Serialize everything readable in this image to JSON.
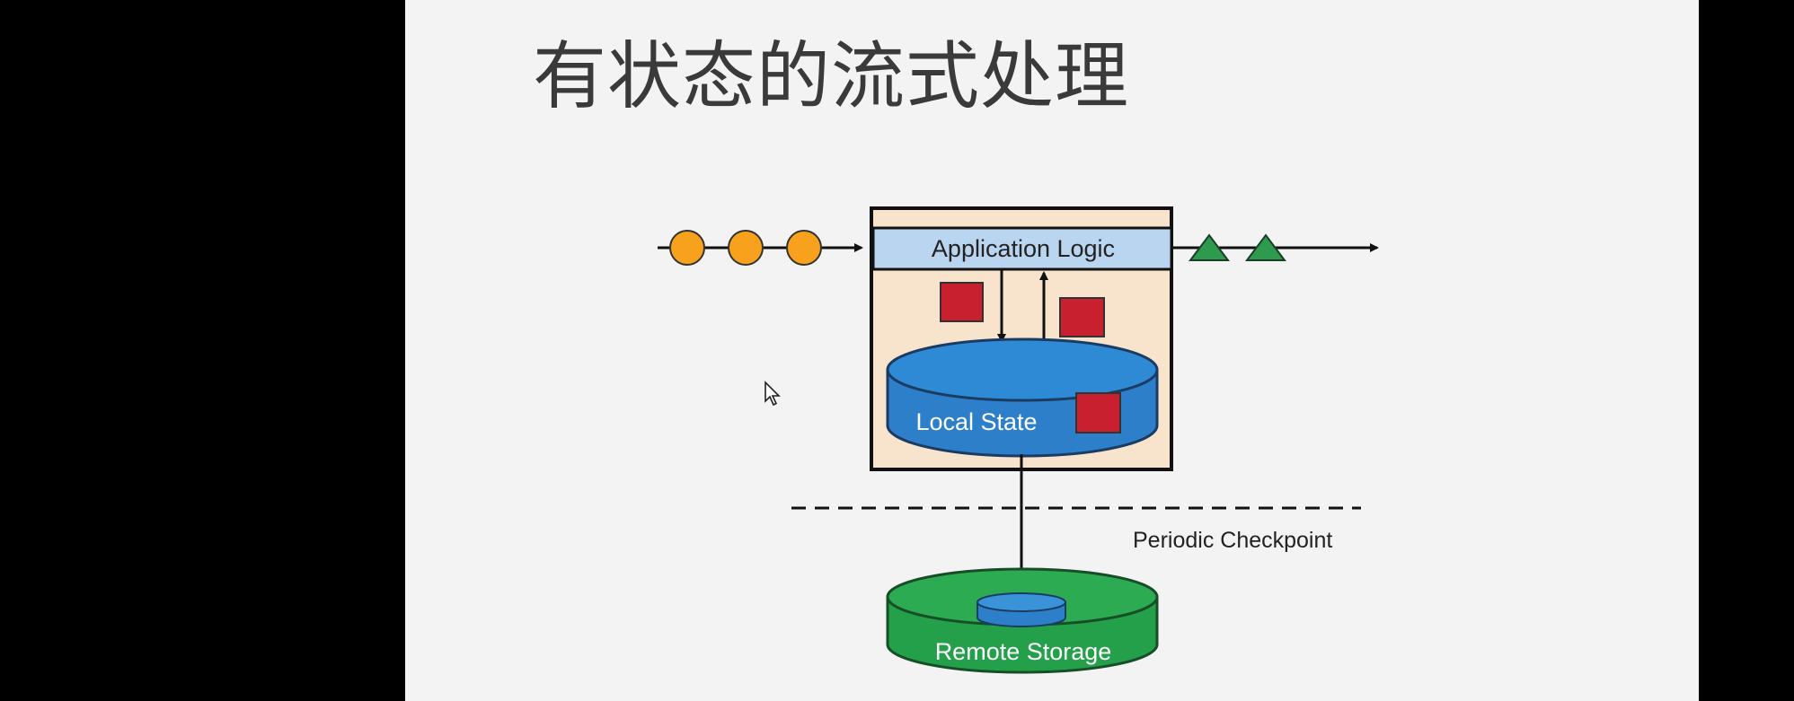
{
  "slide": {
    "title": "有状态的流式处理"
  },
  "diagram": {
    "application_label": "Application Logic",
    "local_state_label": "Local State",
    "checkpoint_label": "Periodic Checkpoint",
    "remote_storage_label": "Remote Storage",
    "input_event_count": 3,
    "output_result_count": 2,
    "state_item_count": 3,
    "colors": {
      "input_event": "#f7a11d",
      "output_result": "#2e9a4e",
      "state_item": "#c8202f",
      "app_logic_bar": "#b9d5ef",
      "operator_box": "#f8e3cc",
      "local_state": "#2d7fc9",
      "remote_storage": "#24a04a",
      "title": "#3a3a3a",
      "slide_background": "#f3f3f3"
    }
  }
}
